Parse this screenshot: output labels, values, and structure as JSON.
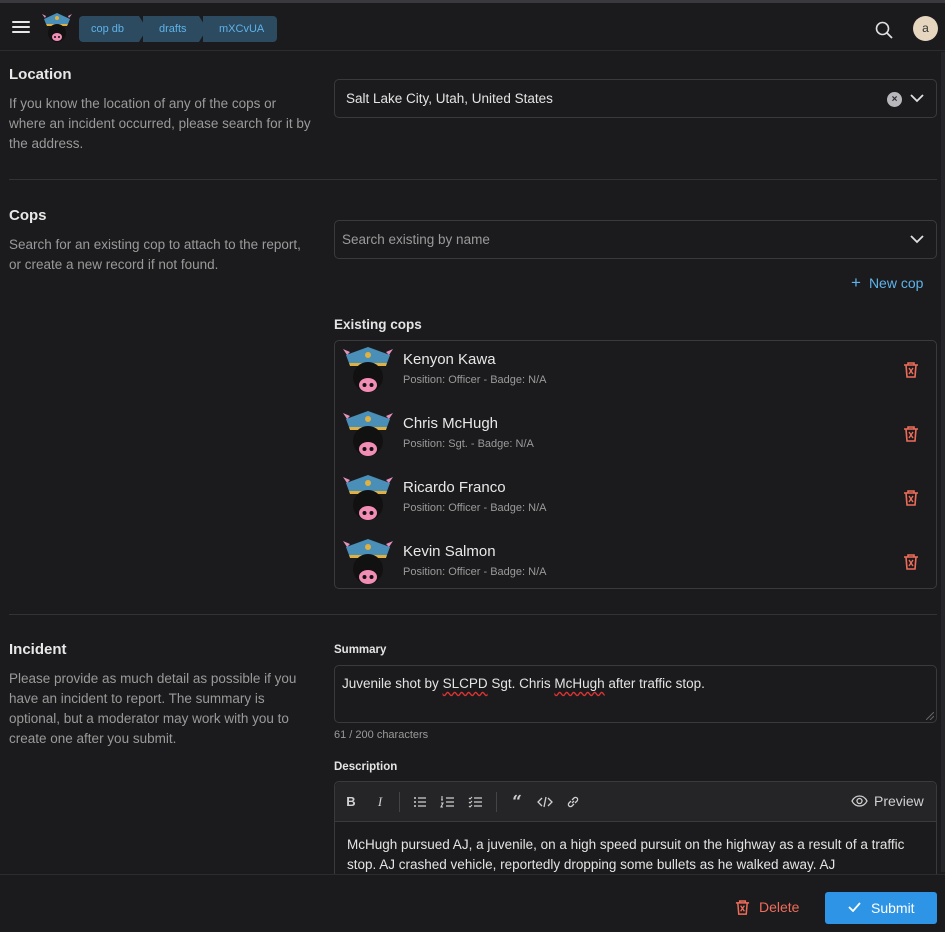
{
  "breadcrumbs": [
    "cop db",
    "drafts",
    "mXCvUA"
  ],
  "user": {
    "avatar_letter": "a"
  },
  "location": {
    "title": "Location",
    "description": "If you know the location of any of the cops or where an incident occurred, please search for it by the address.",
    "value": "Salt Lake City, Utah, United States"
  },
  "cops": {
    "title": "Cops",
    "description": "Search for an existing cop to attach to the report, or create a new record if not found.",
    "search_placeholder": "Search existing by name",
    "new_cop_label": "New cop",
    "existing_label": "Existing cops",
    "items": [
      {
        "name": "Kenyon Kawa",
        "meta": "Position: Officer - Badge: N/A"
      },
      {
        "name": "Chris McHugh",
        "meta": "Position: Sgt. - Badge: N/A"
      },
      {
        "name": "Ricardo Franco",
        "meta": "Position: Officer - Badge: N/A"
      },
      {
        "name": "Kevin Salmon",
        "meta": "Position: Officer - Badge: N/A"
      }
    ]
  },
  "incident": {
    "title": "Incident",
    "description": "Please provide as much detail as possible if you have an incident to report. The summary is optional, but a moderator may work with you to create one after you submit.",
    "summary_label": "Summary",
    "summary_parts": [
      "Juvenile shot by ",
      "SLCPD",
      " Sgt. Chris ",
      "McHugh",
      " after traffic stop."
    ],
    "char_count": "61 / 200 characters",
    "description_label": "Description",
    "preview_label": "Preview",
    "description_text": "McHugh pursued AJ, a juvenile, on a high speed pursuit on the highway as a result of a traffic stop. AJ crashed vehicle, reportedly dropping some bullets as he walked away. AJ"
  },
  "footer": {
    "delete_label": "Delete",
    "submit_label": "Submit"
  },
  "colors": {
    "accent": "#2d94e6",
    "link": "#5eb3ea",
    "danger": "#ef6c5a",
    "background": "#1b1b1d"
  }
}
